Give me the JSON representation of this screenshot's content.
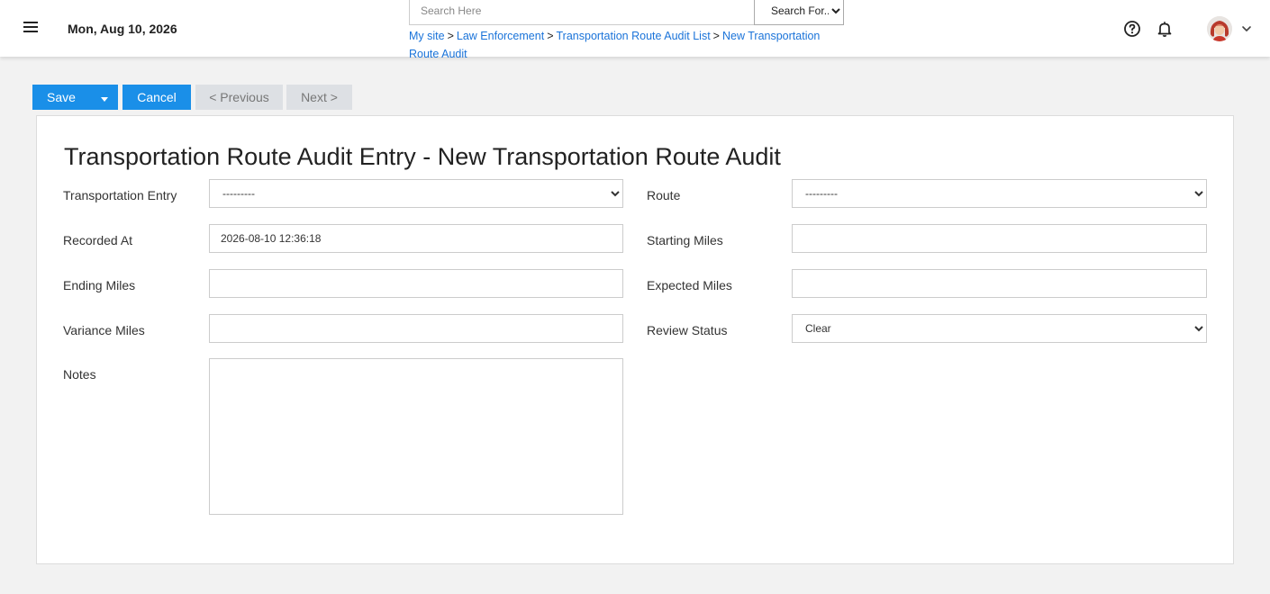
{
  "header": {
    "date": "Mon, Aug 10, 2026",
    "search_placeholder": "Search Here",
    "search_for_label": "Search For...",
    "breadcrumb": [
      {
        "label": "My site"
      },
      {
        "label": "Law Enforcement"
      },
      {
        "label": "Transportation Route Audit List"
      },
      {
        "label": "New Transportation Route Audit"
      }
    ],
    "separator": ">",
    "icons": [
      "menu-icon",
      "help-icon",
      "bell-icon",
      "chevron-down-icon"
    ]
  },
  "toolbar": {
    "save": "Save",
    "cancel": "Cancel",
    "previous": "< Previous",
    "next": "Next >"
  },
  "form": {
    "title": "Transportation Route Audit Entry - New Transportation Route Audit",
    "transportation_entry": {
      "label": "Transportation Entry",
      "value": "---------"
    },
    "route": {
      "label": "Route",
      "value": "---------"
    },
    "recorded_at": {
      "label": "Recorded At",
      "value": "2026-08-10 12:36:18"
    },
    "starting_miles": {
      "label": "Starting Miles",
      "value": ""
    },
    "ending_miles": {
      "label": "Ending Miles",
      "value": ""
    },
    "expected_miles": {
      "label": "Expected Miles",
      "value": ""
    },
    "variance_miles": {
      "label": "Variance Miles",
      "value": ""
    },
    "review_status": {
      "label": "Review Status",
      "value": "Clear"
    },
    "notes": {
      "label": "Notes",
      "value": ""
    }
  },
  "colors": {
    "primary": "#1a8fe8",
    "link": "#1a73d9",
    "disabled_button": "#dde0e4"
  }
}
